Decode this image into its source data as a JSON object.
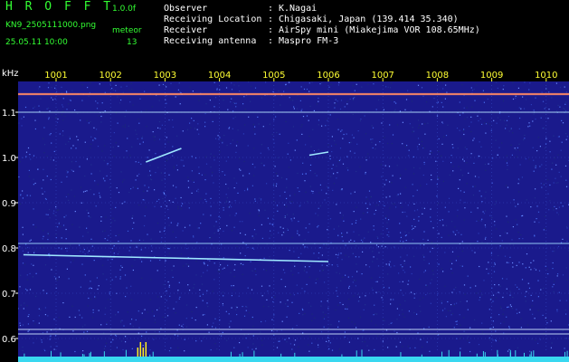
{
  "header": {
    "logo": "H R O F F T",
    "version": "1.0.0f",
    "filename": "KN9_2505111000.png",
    "datetime": "25.05.11 10:00",
    "meteor_label": "meteor",
    "meteor_count": "13",
    "info": [
      {
        "label": "Observer",
        "value": "K.Nagai"
      },
      {
        "label": "Receiving Location",
        "value": "Chigasaki, Japan (139.414 35.340)"
      },
      {
        "label": "Receiver",
        "value": "AirSpy mini (Miakejima VOR 108.65MHz)"
      },
      {
        "label": "Receiving antenna",
        "value": "Maspro FM-3"
      }
    ]
  },
  "colors": {
    "background": "#000000",
    "plot_background": "#1a1a8c",
    "header_green": "#33ff33",
    "axis_yellow": "#ffff33"
  },
  "chart_data": {
    "type": "heatmap",
    "ylabel": "kHz",
    "x_tick_labels": [
      "1001",
      "1002",
      "1003",
      "1004",
      "1005",
      "1006",
      "1007",
      "1008",
      "1009",
      "1010"
    ],
    "y_ticks": [
      1.1,
      1.0,
      0.9,
      0.8,
      0.7,
      0.6
    ],
    "y_tick_labels": [
      "1.1",
      "1.0",
      "0.9",
      "0.8",
      "0.7",
      "0.6"
    ],
    "ylim": [
      0.56,
      1.16
    ],
    "xlim": [
      1000.4,
      1010.3
    ],
    "grid": true,
    "horizontal_lines_khz": [
      1.14,
      1.1,
      0.81,
      0.62,
      0.61
    ],
    "meteor_echoes": [
      {
        "x": [
          1000.4,
          1006.0
        ],
        "y": [
          0.785,
          0.77
        ]
      },
      {
        "x": [
          1002.65,
          1003.3
        ],
        "y": [
          0.99,
          1.02
        ]
      },
      {
        "x": [
          1005.65,
          1006.0
        ],
        "y": [
          1.005,
          1.012
        ]
      }
    ]
  }
}
